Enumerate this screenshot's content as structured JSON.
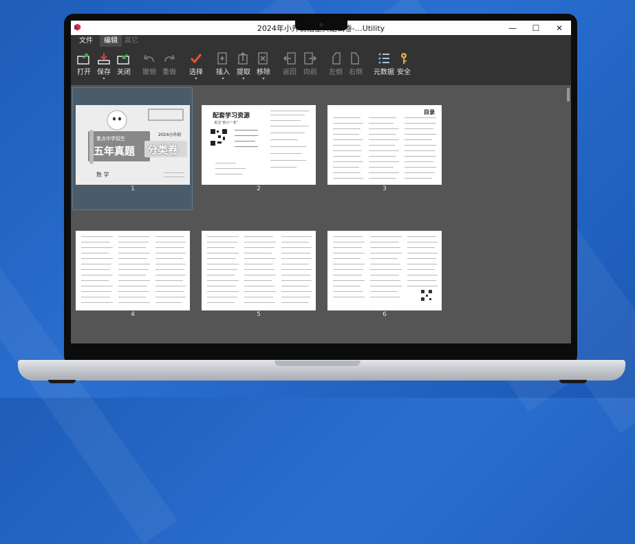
{
  "window": {
    "title": "2024年小升初招生真题试卷-…Utility",
    "minimize_glyph": "—",
    "maximize_glyph": "☐",
    "close_glyph": "✕"
  },
  "menu": {
    "items": [
      {
        "label": "文件",
        "state": "normal"
      },
      {
        "label": "编辑",
        "state": "active"
      },
      {
        "label": "其它",
        "state": "disabled"
      }
    ]
  },
  "toolbar": {
    "open": "打开",
    "save": "保存",
    "close": "关闭",
    "undo": "撤销",
    "redo": "重做",
    "select": "选择",
    "insert": "插入",
    "extract": "提取",
    "remove": "移除",
    "back": "返回",
    "forward": "向前",
    "rotate_left": "左倒",
    "rotate_right": "右倒",
    "metadata": "元数据",
    "security": "安全",
    "caret": "▾"
  },
  "pages": [
    {
      "number": "1",
      "kind": "cover",
      "selected": true
    },
    {
      "number": "2",
      "kind": "resources"
    },
    {
      "number": "3",
      "kind": "toc"
    },
    {
      "number": "4",
      "kind": "text"
    },
    {
      "number": "5",
      "kind": "text"
    },
    {
      "number": "6",
      "kind": "text"
    }
  ],
  "cover": {
    "top_text": "重点中学招生",
    "year_text": "2024小升初",
    "title": "五年真题",
    "subtitle": "分类卷",
    "subject": "数 学"
  },
  "page2": {
    "heading": "配套学习资源",
    "subheading": "关注“初小一本”"
  },
  "page3": {
    "heading": "目录"
  },
  "colors": {
    "accent_blue": "#2a6fd0",
    "toolbar_bg": "#333333",
    "content_bg": "#555555",
    "select_check": "#e8533b",
    "open_green": "#3cb043",
    "save_red": "#e0404a",
    "key_gold": "#d7a94a"
  }
}
